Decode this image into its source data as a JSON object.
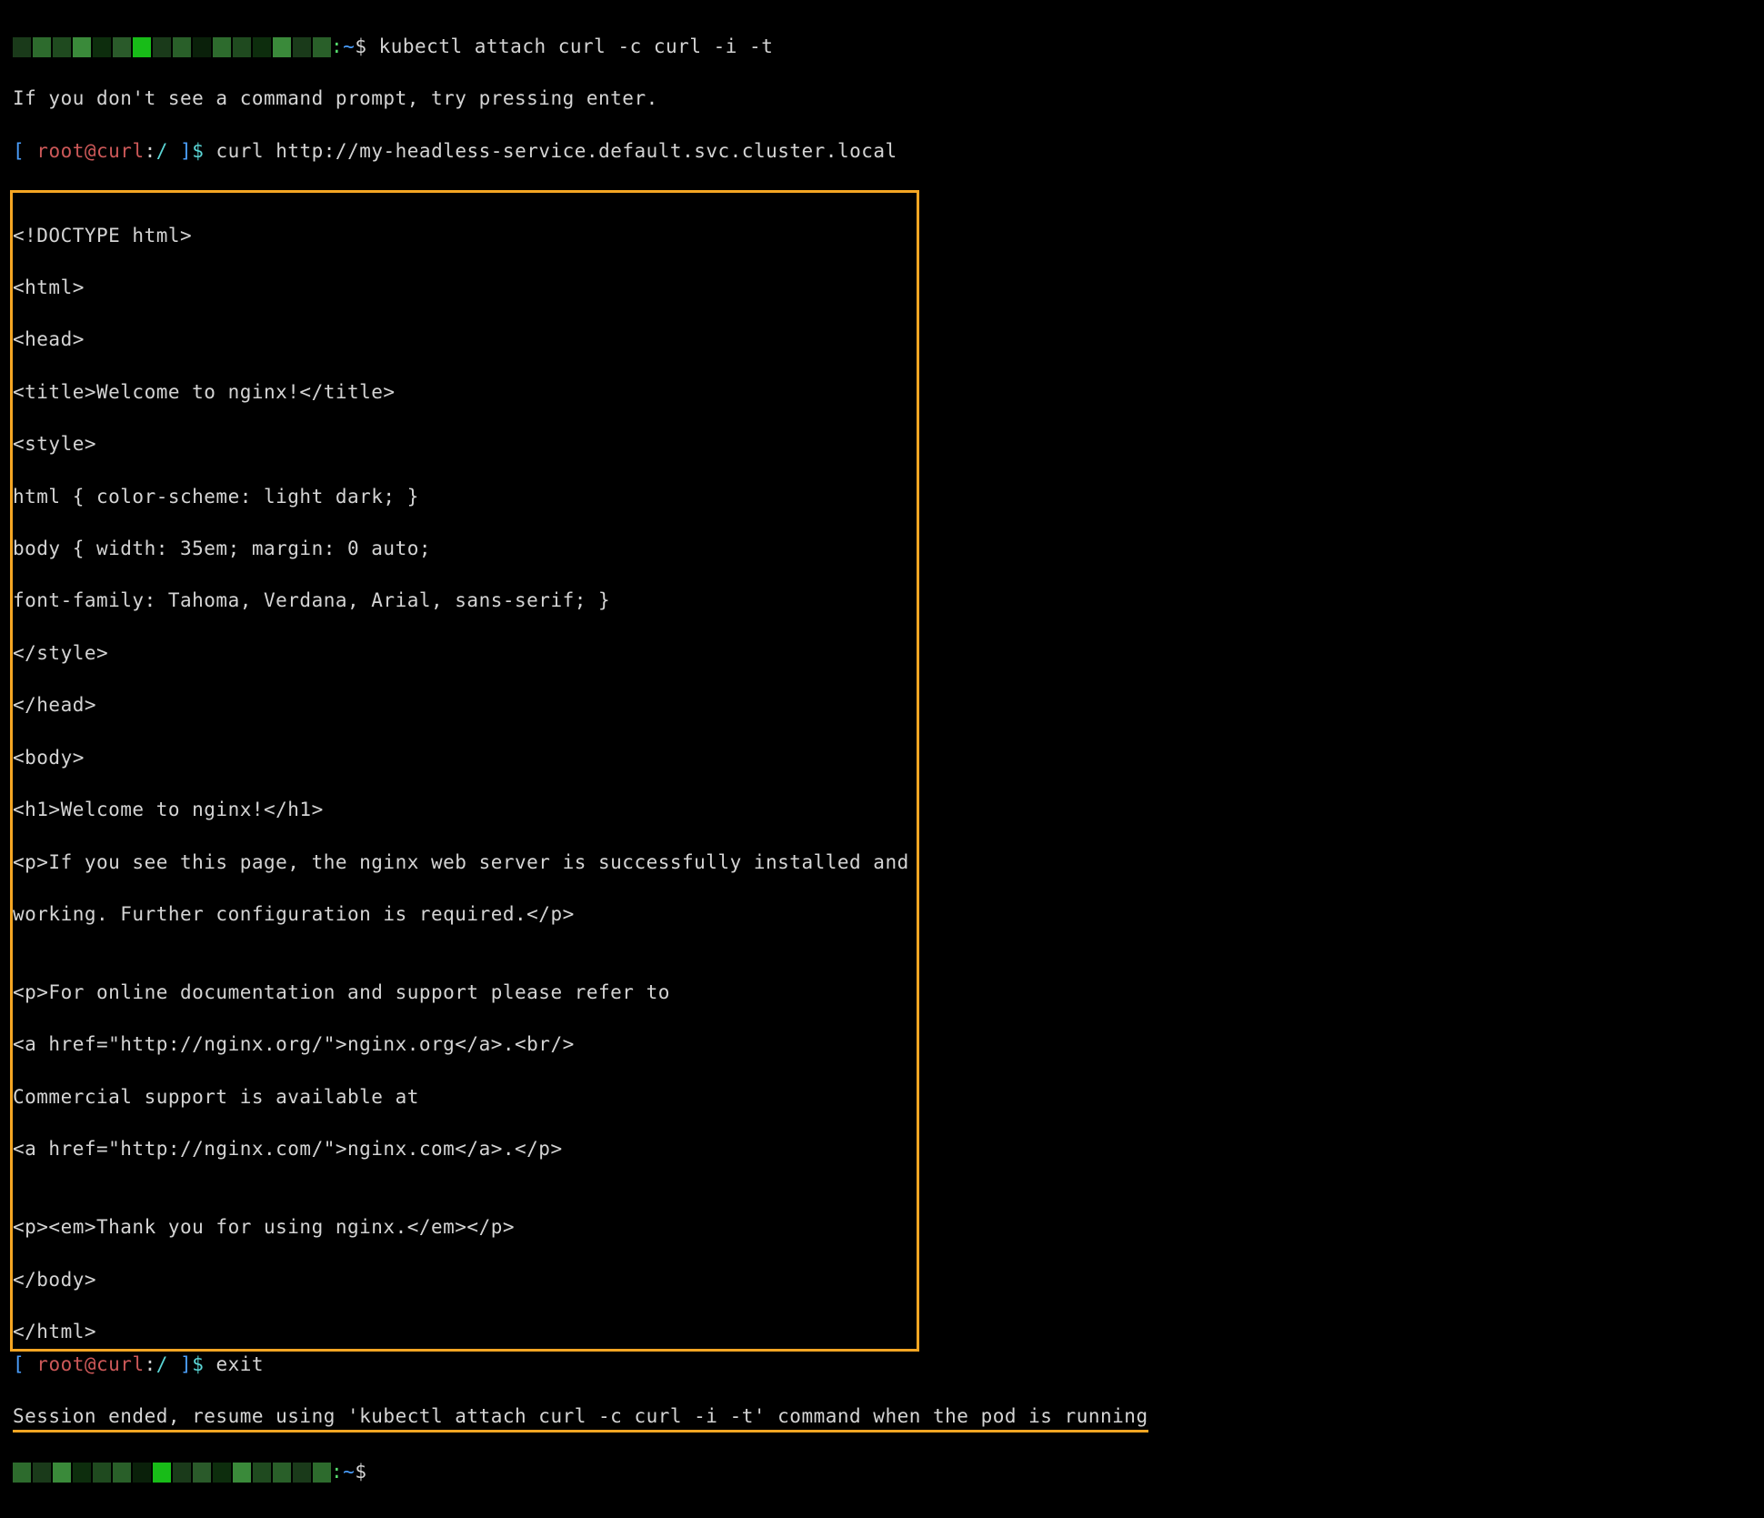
{
  "line1": {
    "host_suffix": ":",
    "cwd": "~",
    "sep": "$ ",
    "cmd": "kubectl attach curl -c curl -i -t"
  },
  "line2": "If you don't see a command prompt, try pressing enter.",
  "prompt1": {
    "lb": "[ ",
    "user": "root@curl",
    "colon": ":",
    "path": "/ ",
    "rb": "]",
    "dollar": "$ "
  },
  "cmd_curl": "curl http://my-headless-service.default.svc.cluster.local",
  "nginx_out": [
    "<!DOCTYPE html>",
    "<html>",
    "<head>",
    "<title>Welcome to nginx!</title>",
    "<style>",
    "html { color-scheme: light dark; }",
    "body { width: 35em; margin: 0 auto;",
    "font-family: Tahoma, Verdana, Arial, sans-serif; }",
    "</style>",
    "</head>",
    "<body>",
    "<h1>Welcome to nginx!</h1>",
    "<p>If you see this page, the nginx web server is successfully installed and",
    "working. Further configuration is required.</p>",
    "",
    "<p>For online documentation and support please refer to",
    "<a href=\"http://nginx.org/\">nginx.org</a>.<br/>",
    "Commercial support is available at",
    "<a href=\"http://nginx.com/\">nginx.com</a>.</p>",
    "",
    "<p><em>Thank you for using nginx.</em></p>",
    "</body>",
    "</html>"
  ],
  "cmd_exit": "exit",
  "session_msg": "Session ended, resume using 'kubectl attach curl -c curl -i -t' command when the pod is running",
  "line_last": {
    "host_suffix": ":",
    "cwd": "~",
    "sep": "$ "
  }
}
